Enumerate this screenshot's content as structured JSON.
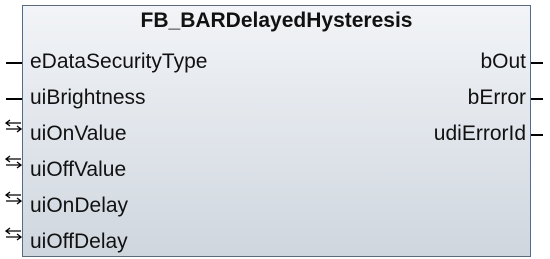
{
  "block": {
    "name": "FB_BARDelayedHysteresis"
  },
  "inputs": [
    "eDataSecurityType",
    "uiBrightness"
  ],
  "in_outs": [
    "uiOnValue",
    "uiOffValue",
    "uiOnDelay",
    "uiOffDelay"
  ],
  "outputs": [
    "bOut",
    "bError",
    "udiErrorId"
  ]
}
